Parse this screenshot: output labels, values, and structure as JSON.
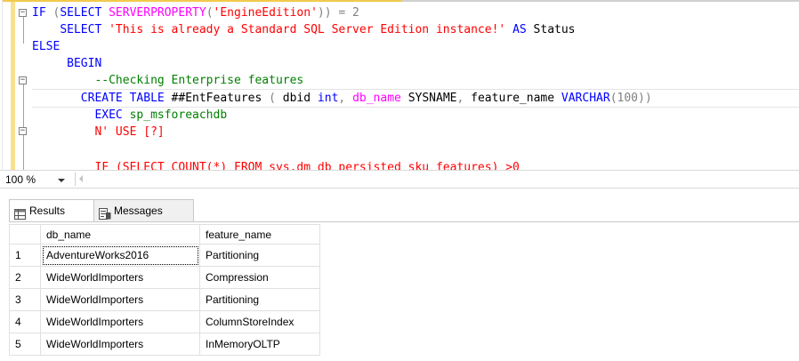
{
  "editor": {
    "lines": {
      "l1": {
        "kw1": "IF",
        "punct1": " (",
        "kw2": "SELECT",
        "fn1": "SERVERPROPERTY",
        "punct2": "(",
        "str1": "'EngineEdition'",
        "punct3": ")) = 2"
      },
      "l2": {
        "kw1": "SELECT",
        "str1": "'This is already a Standard SQL Server Edition instance!'",
        "kw2": "AS",
        "plain1": "Status"
      },
      "l3": {
        "kw1": "ELSE"
      },
      "l4": {
        "kw1": "BEGIN"
      },
      "l5": {
        "cmt1": "--Checking Enterprise features"
      },
      "l6": {
        "kw1": "CREATE TABLE",
        "plain1": "##EntFeatures",
        "punct1": "(",
        "plain2": "dbid",
        "kw2": "int",
        "punct2": ",",
        "fn1": "db_name",
        "plain3": "SYSNAME",
        "punct3": ",",
        "plain4": "feature_name",
        "kw3": "VARCHAR",
        "punct4": "(100))"
      },
      "l7": {
        "kw1": "EXEC",
        "sys1": "sp_msforeachdb"
      },
      "l8": {
        "str1": "N' USE [?]"
      },
      "l9": {
        "str1": "IF (SELECT COUNT(*) FROM sys.dm_db_persisted_sku_features) >0"
      }
    }
  },
  "zoom": {
    "value": "100 %"
  },
  "results": {
    "tabs": {
      "results_label": "Results",
      "messages_label": "Messages"
    },
    "columns": {
      "db_name": "db_name",
      "feature_name": "feature_name"
    },
    "rows": [
      {
        "index": "1",
        "db_name": "AdventureWorks2016",
        "feature_name": "Partitioning"
      },
      {
        "index": "2",
        "db_name": "WideWorldImporters",
        "feature_name": "Compression"
      },
      {
        "index": "3",
        "db_name": "WideWorldImporters",
        "feature_name": "Partitioning"
      },
      {
        "index": "4",
        "db_name": "WideWorldImporters",
        "feature_name": "ColumnStoreIndex"
      },
      {
        "index": "5",
        "db_name": "WideWorldImporters",
        "feature_name": "InMemoryOLTP"
      }
    ]
  },
  "icons": {
    "fold_collapse": "collapse-box-icon",
    "zoom_dropdown": "chevron-down-icon",
    "results_tab": "grid-icon",
    "messages_tab": "messages-icon"
  },
  "colors": {
    "keyword": "#0000ff",
    "string": "#ff0000",
    "function": "#ff00ff",
    "comment": "#008000",
    "change_bar": "#f8e08e"
  }
}
